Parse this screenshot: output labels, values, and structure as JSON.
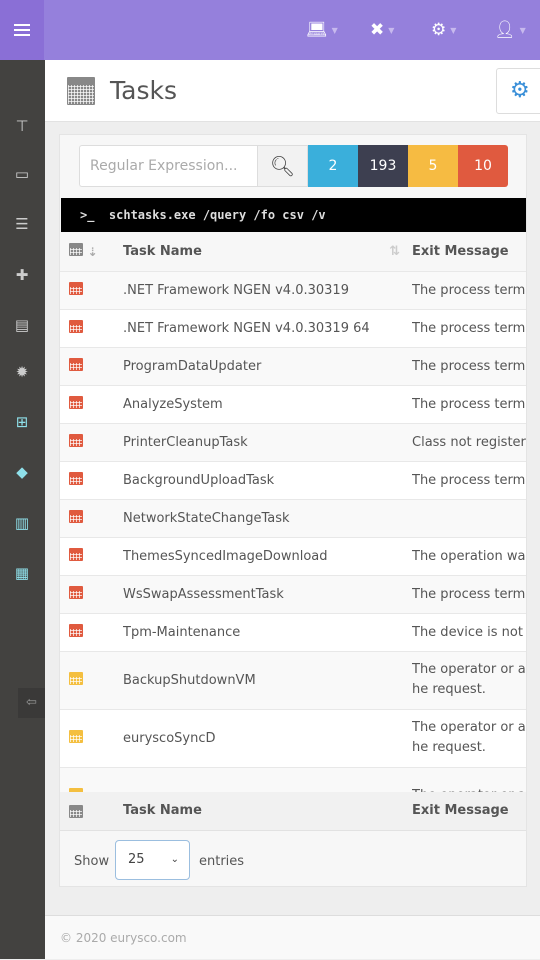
{
  "topbar": {
    "menu_icon": "hamburger-icon",
    "icons": [
      "laptop-icon",
      "tools-icon",
      "gears-icon",
      "user-icon"
    ]
  },
  "sidebar": {
    "icons": [
      "sitemap-icon",
      "monitor-chart-icon",
      "list-window-icon",
      "clipboard-plus-icon",
      "file-chart-icon",
      "cog-burst-icon",
      "windows-icon",
      "tag-icon",
      "barcode-icon",
      "server-clock-icon"
    ],
    "logout_icon": "sign-out-icon"
  },
  "header": {
    "title": "Tasks"
  },
  "search": {
    "placeholder": "Regular Expression...",
    "value": ""
  },
  "badges": [
    {
      "label": "2",
      "color": "#3aafdb"
    },
    {
      "label": "193",
      "color": "#3d3f50"
    },
    {
      "label": "5",
      "color": "#f6bb42"
    },
    {
      "label": "10",
      "color": "#e05a3f"
    }
  ],
  "command": "schtasks.exe /query /fo csv /v",
  "command_prompt": ">_",
  "table": {
    "columns": [
      "Task Name",
      "Exit Message"
    ],
    "rows": [
      {
        "status": "red",
        "name": ".NET Framework NGEN v4.0.30319",
        "message": "The process termin"
      },
      {
        "status": "red",
        "name": ".NET Framework NGEN v4.0.30319 64",
        "message": "The process termin"
      },
      {
        "status": "red",
        "name": "ProgramDataUpdater",
        "message": "The process termin"
      },
      {
        "status": "red",
        "name": "AnalyzeSystem",
        "message": "The process termin"
      },
      {
        "status": "red",
        "name": "PrinterCleanupTask",
        "message": "Class not registere"
      },
      {
        "status": "red",
        "name": "BackgroundUploadTask",
        "message": "The process termin"
      },
      {
        "status": "red",
        "name": "NetworkStateChangeTask",
        "message": ""
      },
      {
        "status": "red",
        "name": "ThemesSyncedImageDownload",
        "message": "The operation was"
      },
      {
        "status": "red",
        "name": "WsSwapAssessmentTask",
        "message": "The process termin"
      },
      {
        "status": "red",
        "name": "Tpm-Maintenance",
        "message": "The device is not re"
      },
      {
        "status": "yellow",
        "name": "BackupShutdownVM",
        "message": "The operator or ad he request."
      },
      {
        "status": "yellow",
        "name": "euryscoSyncD",
        "message": "The operator or ad he request."
      },
      {
        "status": "yellow",
        "name": "",
        "message": "The operator or ad"
      }
    ]
  },
  "length": {
    "show": "Show",
    "value": "25",
    "entries": "entries"
  },
  "footer": "© 2020   eurysco.com"
}
